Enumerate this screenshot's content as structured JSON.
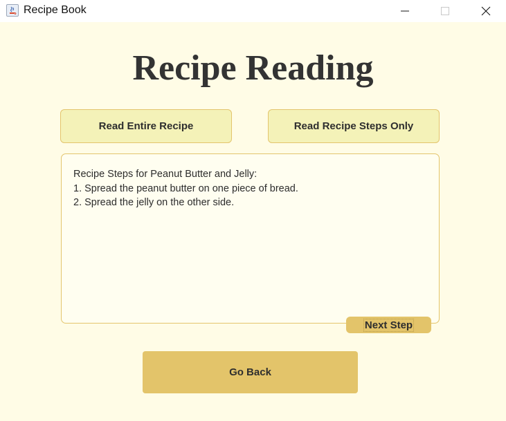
{
  "window": {
    "title": "Recipe Book",
    "controls": [
      "minimize",
      "maximize",
      "close"
    ]
  },
  "page": {
    "heading": "Recipe Reading"
  },
  "buttons": {
    "read_entire": "Read Entire Recipe",
    "read_steps": "Read Recipe Steps Only",
    "next_step": "Next Step",
    "go_back": "Go Back"
  },
  "recipe_text": {
    "lines": [
      "Recipe Steps for Peanut Butter and Jelly:",
      "1. Spread the peanut butter on one piece of bread.",
      "2. Spread the jelly on the other side."
    ]
  },
  "colors": {
    "background": "#fffce6",
    "button_light": "#f4f2b8",
    "button_accent": "#e3c46a",
    "border": "#e3c46c"
  }
}
